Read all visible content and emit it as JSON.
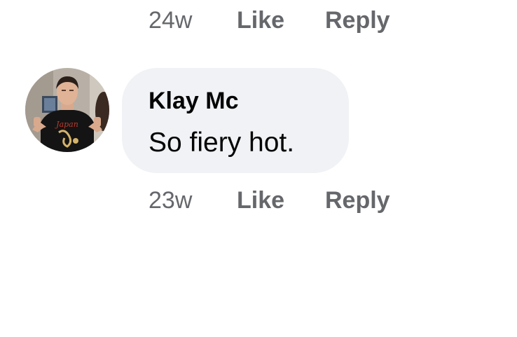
{
  "previous_comment": {
    "timestamp": "24w",
    "like_label": "Like",
    "reply_label": "Reply"
  },
  "comment": {
    "author": "Klay Mc",
    "text": "So fiery hot.",
    "timestamp": "23w",
    "like_label": "Like",
    "reply_label": "Reply",
    "avatar": {
      "shirt_text": "Japan"
    }
  },
  "colors": {
    "meta_text": "#65676b",
    "bubble_bg": "#f0f2f5",
    "primary_text": "#050505"
  }
}
